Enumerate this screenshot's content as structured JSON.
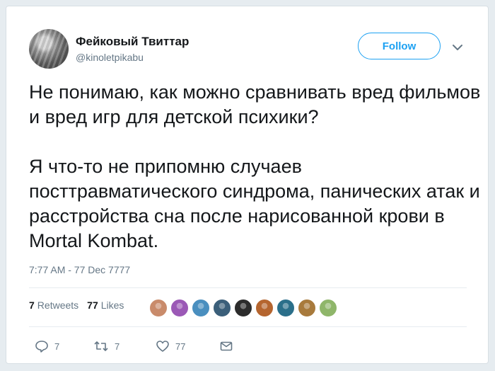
{
  "user": {
    "name": "Фейковый Твиттар",
    "handle": "@kinoletpikabu",
    "follow_label": "Follow"
  },
  "tweet": {
    "paragraphs": [
      "Не понимаю, как можно сравнивать вред фильмов и вред игр для детской психики?",
      "Я что-то не припомню случаев посттравматического синдрома, панических атак и расстройства сна после нарисованной крови в Mortal Kombat."
    ],
    "timestamp": "7:77 AM - 77 Dec 7777"
  },
  "stats": {
    "retweets_count": "7",
    "retweets_label": "Retweets",
    "likes_count": "77",
    "likes_label": "Likes"
  },
  "likers": [
    {
      "icon": "liker-avatar",
      "color": "#c98b6b"
    },
    {
      "icon": "liker-avatar",
      "color": "#9b59b6"
    },
    {
      "icon": "liker-avatar",
      "color": "#4a8fbf"
    },
    {
      "icon": "liker-avatar",
      "color": "#3b5f7a"
    },
    {
      "icon": "liker-avatar",
      "color": "#2c2c2c"
    },
    {
      "icon": "liker-avatar",
      "color": "#b5652f"
    },
    {
      "icon": "liker-avatar",
      "color": "#2b6f8a"
    },
    {
      "icon": "liker-avatar",
      "color": "#a87a3c"
    },
    {
      "icon": "liker-avatar",
      "color": "#8fb66a"
    }
  ],
  "actions": {
    "reply_count": "7",
    "retweet_count": "7",
    "like_count": "77"
  },
  "colors": {
    "accent": "#1da1f2",
    "text": "#14171a",
    "muted": "#657786"
  }
}
